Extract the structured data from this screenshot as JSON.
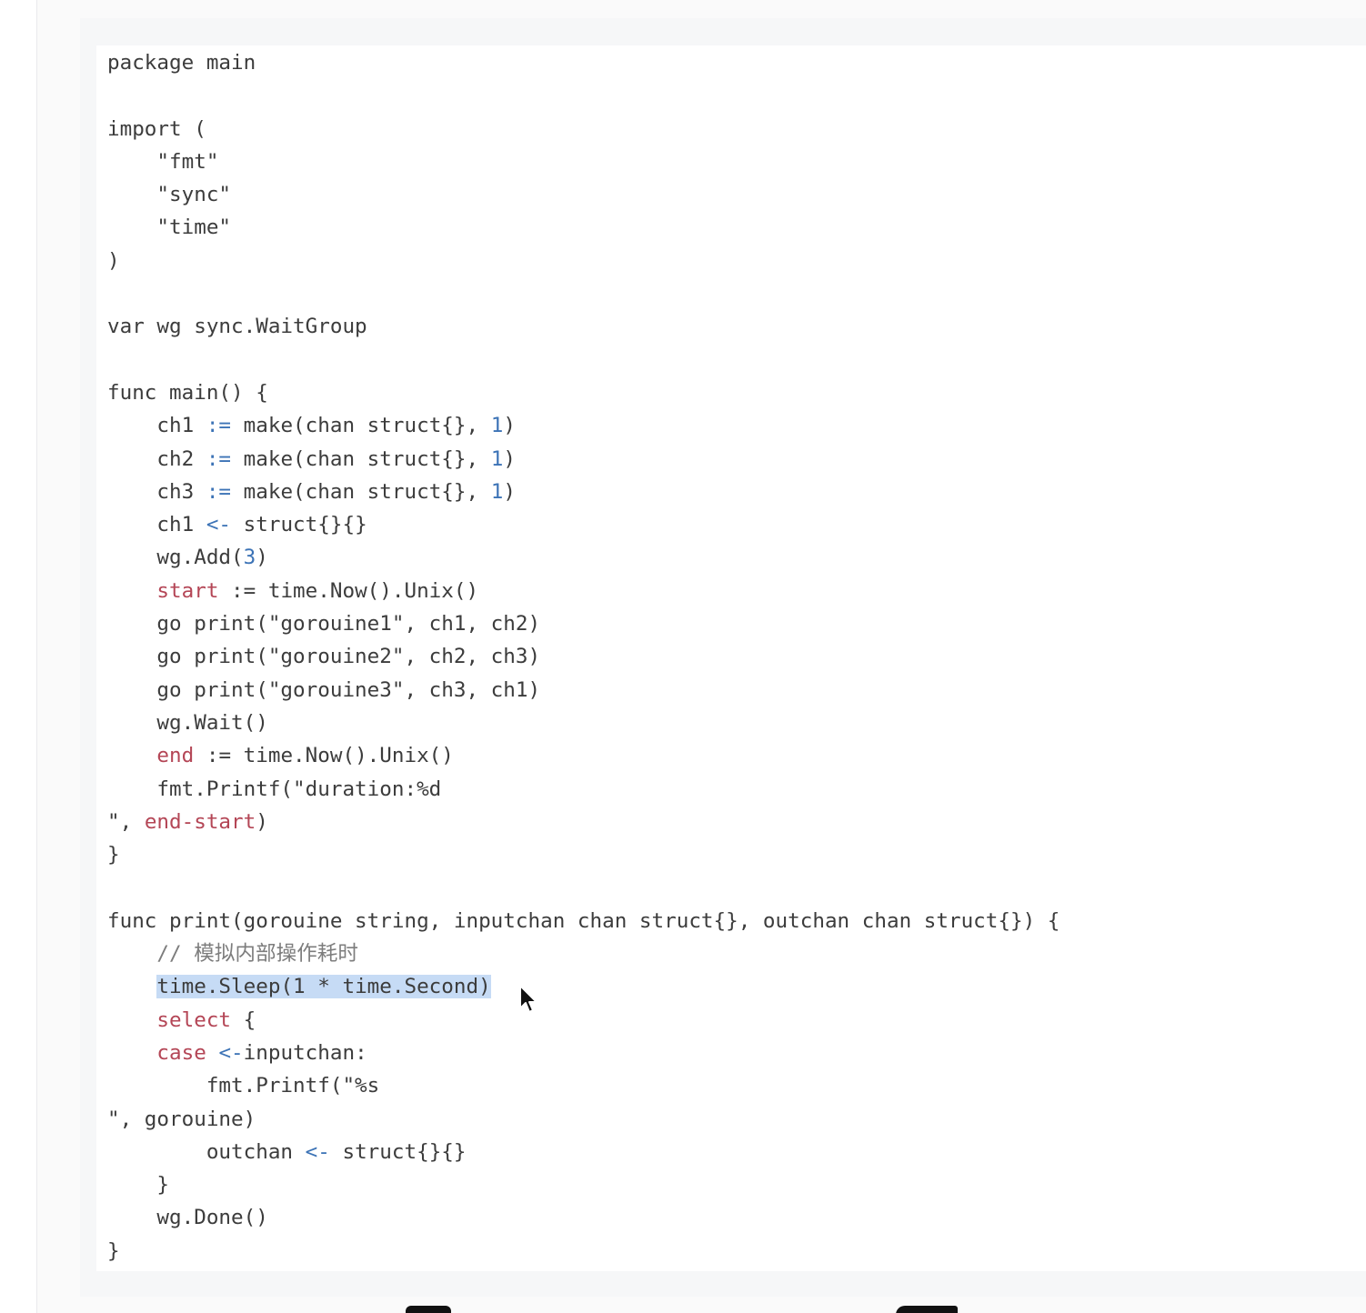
{
  "editor": {
    "language": "go",
    "colors": {
      "plain": "#3c3c3c",
      "number": "#3c73b6",
      "operator": "#3c73b6",
      "variable": "#b44656",
      "keyword": "#b44656",
      "comment": "#7d7d7d",
      "selection": "#c6dbf5"
    },
    "lines": [
      [
        {
          "t": "plain",
          "v": "package main"
        }
      ],
      [],
      [
        {
          "t": "plain",
          "v": "import ("
        }
      ],
      [
        {
          "t": "plain",
          "v": "    \"fmt\""
        }
      ],
      [
        {
          "t": "plain",
          "v": "    \"sync\""
        }
      ],
      [
        {
          "t": "plain",
          "v": "    \"time\""
        }
      ],
      [
        {
          "t": "plain",
          "v": ")"
        }
      ],
      [],
      [
        {
          "t": "plain",
          "v": "var wg sync.WaitGroup"
        }
      ],
      [],
      [
        {
          "t": "plain",
          "v": "func main() {"
        }
      ],
      [
        {
          "t": "plain",
          "v": "    ch1 "
        },
        {
          "t": "op",
          "v": ":="
        },
        {
          "t": "plain",
          "v": " make(chan struct{}, "
        },
        {
          "t": "num",
          "v": "1"
        },
        {
          "t": "plain",
          "v": ")"
        }
      ],
      [
        {
          "t": "plain",
          "v": "    ch2 "
        },
        {
          "t": "op",
          "v": ":="
        },
        {
          "t": "plain",
          "v": " make(chan struct{}, "
        },
        {
          "t": "num",
          "v": "1"
        },
        {
          "t": "plain",
          "v": ")"
        }
      ],
      [
        {
          "t": "plain",
          "v": "    ch3 "
        },
        {
          "t": "op",
          "v": ":="
        },
        {
          "t": "plain",
          "v": " make(chan struct{}, "
        },
        {
          "t": "num",
          "v": "1"
        },
        {
          "t": "plain",
          "v": ")"
        }
      ],
      [
        {
          "t": "plain",
          "v": "    ch1 "
        },
        {
          "t": "op",
          "v": "<-"
        },
        {
          "t": "plain",
          "v": " struct{}{}"
        }
      ],
      [
        {
          "t": "plain",
          "v": "    wg.Add("
        },
        {
          "t": "num",
          "v": "3"
        },
        {
          "t": "plain",
          "v": ")"
        }
      ],
      [
        {
          "t": "plain",
          "v": "    "
        },
        {
          "t": "var",
          "v": "start"
        },
        {
          "t": "plain",
          "v": " := time.Now().Unix()"
        }
      ],
      [
        {
          "t": "plain",
          "v": "    go print(\"gorouine1\", ch1, ch2)"
        }
      ],
      [
        {
          "t": "plain",
          "v": "    go print(\"gorouine2\", ch2, ch3)"
        }
      ],
      [
        {
          "t": "plain",
          "v": "    go print(\"gorouine3\", ch3, ch1)"
        }
      ],
      [
        {
          "t": "plain",
          "v": "    wg.Wait()"
        }
      ],
      [
        {
          "t": "plain",
          "v": "    "
        },
        {
          "t": "var",
          "v": "end"
        },
        {
          "t": "plain",
          "v": " := time.Now().Unix()"
        }
      ],
      [
        {
          "t": "plain",
          "v": "    fmt.Printf(\"duration:%d"
        }
      ],
      [
        {
          "t": "plain",
          "v": "\", "
        },
        {
          "t": "var",
          "v": "end-start"
        },
        {
          "t": "plain",
          "v": ")"
        }
      ],
      [
        {
          "t": "plain",
          "v": "}"
        }
      ],
      [],
      [
        {
          "t": "plain",
          "v": "func print(gorouine string, inputchan chan struct{}, outchan chan struct{}) {"
        }
      ],
      [
        {
          "t": "plain",
          "v": "    "
        },
        {
          "t": "comment",
          "v": "// 模拟内部操作耗时"
        }
      ],
      [
        {
          "t": "plain",
          "v": "    "
        },
        {
          "t": "selected",
          "v": "time.Sleep(1 * time.Second)"
        }
      ],
      [
        {
          "t": "plain",
          "v": "    "
        },
        {
          "t": "kw",
          "v": "select"
        },
        {
          "t": "plain",
          "v": " {"
        }
      ],
      [
        {
          "t": "plain",
          "v": "    "
        },
        {
          "t": "kw",
          "v": "case"
        },
        {
          "t": "plain",
          "v": " "
        },
        {
          "t": "op",
          "v": "<-"
        },
        {
          "t": "plain",
          "v": "inputchan:"
        }
      ],
      [
        {
          "t": "plain",
          "v": "        fmt.Printf(\"%s"
        }
      ],
      [
        {
          "t": "plain",
          "v": "\", gorouine)"
        }
      ],
      [
        {
          "t": "plain",
          "v": "        outchan "
        },
        {
          "t": "op",
          "v": "<-"
        },
        {
          "t": "plain",
          "v": " struct{}{}"
        }
      ],
      [
        {
          "t": "plain",
          "v": "    }"
        }
      ],
      [
        {
          "t": "plain",
          "v": "    wg.Done()"
        }
      ],
      [
        {
          "t": "plain",
          "v": "}"
        }
      ]
    ]
  },
  "mouse_cursor": {
    "icon": "arrow-pointer-icon"
  }
}
